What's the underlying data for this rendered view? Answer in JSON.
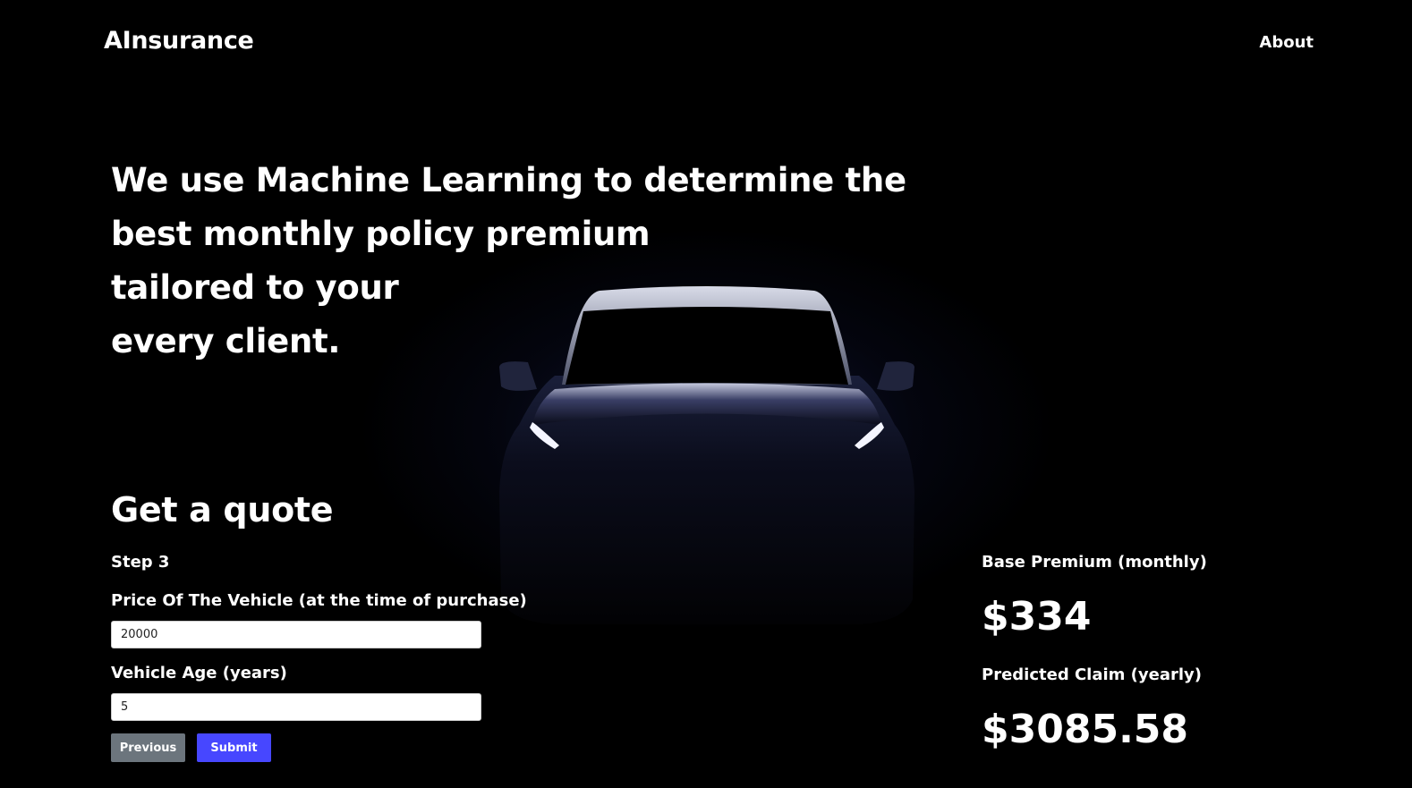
{
  "header": {
    "logo": "AInsurance",
    "nav_about": "About"
  },
  "hero": {
    "lines": [
      "We use Machine Learning to determine the",
      "best monthly policy premium",
      "tailored to your",
      "every client."
    ]
  },
  "quote": {
    "title": "Get a quote",
    "step": "Step 3",
    "fields": [
      {
        "label": "Price Of The Vehicle (at the time of purchase)",
        "value": "20000"
      },
      {
        "label": "Vehicle Age (years)",
        "value": "5"
      }
    ],
    "buttons": {
      "previous": "Previous",
      "submit": "Submit"
    }
  },
  "results": {
    "base_premium_label": "Base Premium (monthly)",
    "base_premium_value": "$334",
    "predicted_claim_label": "Predicted Claim (yearly)",
    "predicted_claim_value": "$3085.58"
  },
  "colors": {
    "background": "#000000",
    "submit_button": "#4747ff",
    "previous_button": "#6c757d",
    "text": "#ffffff"
  }
}
